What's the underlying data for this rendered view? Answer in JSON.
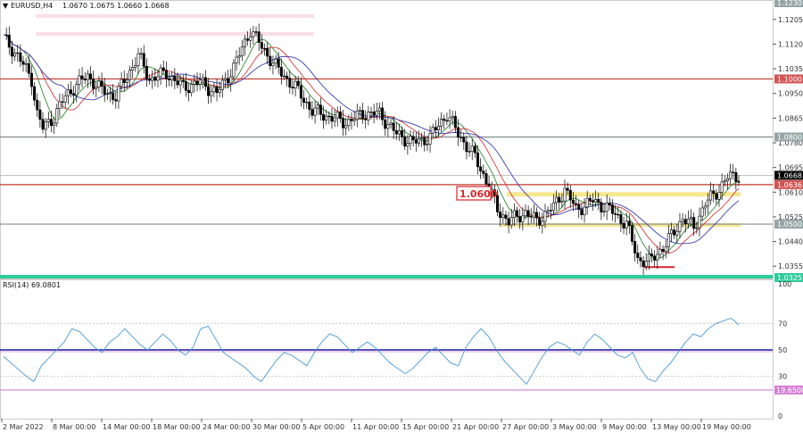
{
  "window": {
    "symbol_title": "EURUSD,H4",
    "ohlc": "1.0670 1.0675 1.0660 1.0668"
  },
  "colors": {
    "background": "#ffffff",
    "candle": "#000000",
    "ma_fast": "#2e8b2e",
    "ma_mid": "#d23c3c",
    "ma_slow": "#3c3cb4",
    "resistance_red": "#c0392b",
    "level_gray": "#7f8c8d",
    "zone_yellow": "#f4e27a",
    "low_band": "#2ecc9a",
    "rsi_line": "#4a9ad4",
    "rsi_mid": "#1a1aa0",
    "rsi_low": "#d580d5",
    "annotation": "#d62728"
  },
  "annotations": {
    "big_level_label": "1.0600"
  },
  "tags": [
    {
      "key": "t1000",
      "text": "1.1000",
      "type": "red"
    },
    {
      "key": "t0800",
      "text": "1.0800",
      "type": "gray"
    },
    {
      "key": "t0668",
      "text": "1.0668",
      "type": "black"
    },
    {
      "key": "t0636",
      "text": "1.0636",
      "type": "red"
    },
    {
      "key": "t0500",
      "text": "1.0500",
      "type": "gray"
    },
    {
      "key": "t0325",
      "text": "1.0325",
      "type": "teal"
    },
    {
      "key": "t1230",
      "text": "1.1230",
      "type": "gray"
    }
  ],
  "rsi": {
    "title": "RSI(14) 69.0801",
    "axis": [
      "100",
      "70",
      "50",
      "30",
      "0"
    ],
    "low_tag": "19.6500"
  },
  "chart_data": [
    {
      "type": "candlestick",
      "title": "EURUSD,H4",
      "y_axis_ticks": [
        "1.1205",
        "1.1120",
        "1.1035",
        "1.0950",
        "1.0865",
        "1.0780",
        "1.0695",
        "1.0610",
        "1.0525",
        "1.0440",
        "1.0355"
      ],
      "ylim": [
        1.0325,
        1.1235
      ],
      "x_axis_dates": [
        "2 Mar 2022",
        "8 Mar 00:00",
        "14 Mar 00:00",
        "18 Mar 00:00",
        "24 Mar 00:00",
        "30 Mar 00:00",
        "5 Apr 00:00",
        "11 Apr 00:00",
        "15 Apr 00:00",
        "21 Apr 00:00",
        "27 Apr 00:00",
        "3 May 00:00",
        "9 May 00:00",
        "13 May 00:00",
        "19 May 00:00"
      ],
      "close_series": [
        {
          "i": 0,
          "v": 1.114
        },
        {
          "i": 5,
          "v": 1.108
        },
        {
          "i": 10,
          "v": 1.1
        },
        {
          "i": 12,
          "v": 1.088
        },
        {
          "i": 14,
          "v": 1.083
        },
        {
          "i": 18,
          "v": 1.087
        },
        {
          "i": 22,
          "v": 1.094
        },
        {
          "i": 26,
          "v": 1.098
        },
        {
          "i": 30,
          "v": 1.101
        },
        {
          "i": 35,
          "v": 1.096
        },
        {
          "i": 40,
          "v": 1.094
        },
        {
          "i": 44,
          "v": 1.101
        },
        {
          "i": 48,
          "v": 1.108
        },
        {
          "i": 52,
          "v": 1.1
        },
        {
          "i": 58,
          "v": 1.102
        },
        {
          "i": 64,
          "v": 1.097
        },
        {
          "i": 70,
          "v": 1.099
        },
        {
          "i": 76,
          "v": 1.095
        },
        {
          "i": 82,
          "v": 1.104
        },
        {
          "i": 88,
          "v": 1.117
        },
        {
          "i": 92,
          "v": 1.111
        },
        {
          "i": 98,
          "v": 1.103
        },
        {
          "i": 104,
          "v": 1.097
        },
        {
          "i": 110,
          "v": 1.089
        },
        {
          "i": 116,
          "v": 1.087
        },
        {
          "i": 122,
          "v": 1.085
        },
        {
          "i": 128,
          "v": 1.088
        },
        {
          "i": 134,
          "v": 1.088
        },
        {
          "i": 140,
          "v": 1.081
        },
        {
          "i": 146,
          "v": 1.078
        },
        {
          "i": 152,
          "v": 1.08
        },
        {
          "i": 158,
          "v": 1.088
        },
        {
          "i": 162,
          "v": 1.081
        },
        {
          "i": 168,
          "v": 1.073
        },
        {
          "i": 172,
          "v": 1.065
        },
        {
          "i": 176,
          "v": 1.055
        },
        {
          "i": 180,
          "v": 1.051
        },
        {
          "i": 186,
          "v": 1.054
        },
        {
          "i": 190,
          "v": 1.051
        },
        {
          "i": 196,
          "v": 1.056
        },
        {
          "i": 200,
          "v": 1.062
        },
        {
          "i": 204,
          "v": 1.055
        },
        {
          "i": 210,
          "v": 1.058
        },
        {
          "i": 216,
          "v": 1.055
        },
        {
          "i": 222,
          "v": 1.05
        },
        {
          "i": 226,
          "v": 1.038
        },
        {
          "i": 230,
          "v": 1.037
        },
        {
          "i": 236,
          "v": 1.043
        },
        {
          "i": 242,
          "v": 1.052
        },
        {
          "i": 246,
          "v": 1.049
        },
        {
          "i": 250,
          "v": 1.057
        },
        {
          "i": 254,
          "v": 1.061
        },
        {
          "i": 258,
          "v": 1.066
        },
        {
          "i": 262,
          "v": 1.0668
        }
      ],
      "horizontal_levels": [
        1.1,
        1.08,
        1.0636,
        1.06,
        1.05,
        1.0325
      ],
      "zones": [
        {
          "label": "1.0600",
          "from": 1.0595,
          "to": 1.061
        }
      ]
    },
    {
      "type": "line",
      "title": "RSI(14) 69.0801",
      "ylim": [
        0,
        100
      ],
      "y_ticks": [
        100,
        70,
        50,
        30,
        0
      ],
      "levels": [
        50,
        19.65
      ],
      "values": [
        45,
        40,
        35,
        30,
        26,
        38,
        44,
        50,
        56,
        66,
        64,
        58,
        52,
        48,
        56,
        60,
        66,
        60,
        54,
        50,
        56,
        62,
        57,
        50,
        46,
        52,
        66,
        68,
        58,
        48,
        44,
        40,
        36,
        30,
        26,
        34,
        42,
        48,
        46,
        42,
        38,
        48,
        56,
        62,
        60,
        54,
        48,
        52,
        56,
        52,
        46,
        40,
        36,
        32,
        36,
        42,
        48,
        52,
        46,
        40,
        38,
        52,
        60,
        66,
        60,
        50,
        42,
        36,
        30,
        24,
        34,
        44,
        52,
        56,
        54,
        50,
        46,
        56,
        62,
        58,
        52,
        46,
        44,
        48,
        36,
        28,
        26,
        34,
        40,
        48,
        56,
        62,
        60,
        66,
        70,
        72,
        74,
        69
      ]
    }
  ]
}
